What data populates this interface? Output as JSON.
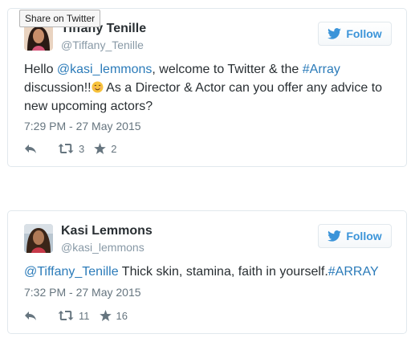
{
  "tooltip": {
    "text": "Share on Twitter"
  },
  "colors": {
    "link": "#2b7bb9",
    "follow": "#3b94d9",
    "muted": "#66757f",
    "border": "#e1e8ed"
  },
  "tweets": [
    {
      "author": {
        "name": "Tiffany Tenille",
        "handle": "@Tiffany_Tenille"
      },
      "follow_label": "Follow",
      "text": {
        "t1": "Hello ",
        "mention": "@kasi_lemmons",
        "t2": ", welcome to Twitter & the ",
        "hashtag": "#Array",
        "t3": " discussion!!",
        "emoji": "smiling-face-emoji",
        "t4": " As a Director & Actor can you offer any advice to new upcoming actors?"
      },
      "time": "7:29 PM - 27 May 2015",
      "retweets": "3",
      "favorites": "2",
      "icons": {
        "reply": "reply-icon",
        "retweet": "retweet-icon",
        "favorite": "star-icon",
        "follow": "twitter-bird-icon"
      }
    },
    {
      "author": {
        "name": "Kasi Lemmons",
        "handle": "@kasi_lemmons"
      },
      "follow_label": "Follow",
      "text": {
        "mention": "@Tiffany_Tenille",
        "t1": " Thick skin, stamina, faith in yourself.",
        "hashtag": "#ARRAY"
      },
      "time": "7:32 PM - 27 May 2015",
      "retweets": "11",
      "favorites": "16",
      "icons": {
        "reply": "reply-icon",
        "retweet": "retweet-icon",
        "favorite": "star-icon",
        "follow": "twitter-bird-icon"
      }
    }
  ]
}
